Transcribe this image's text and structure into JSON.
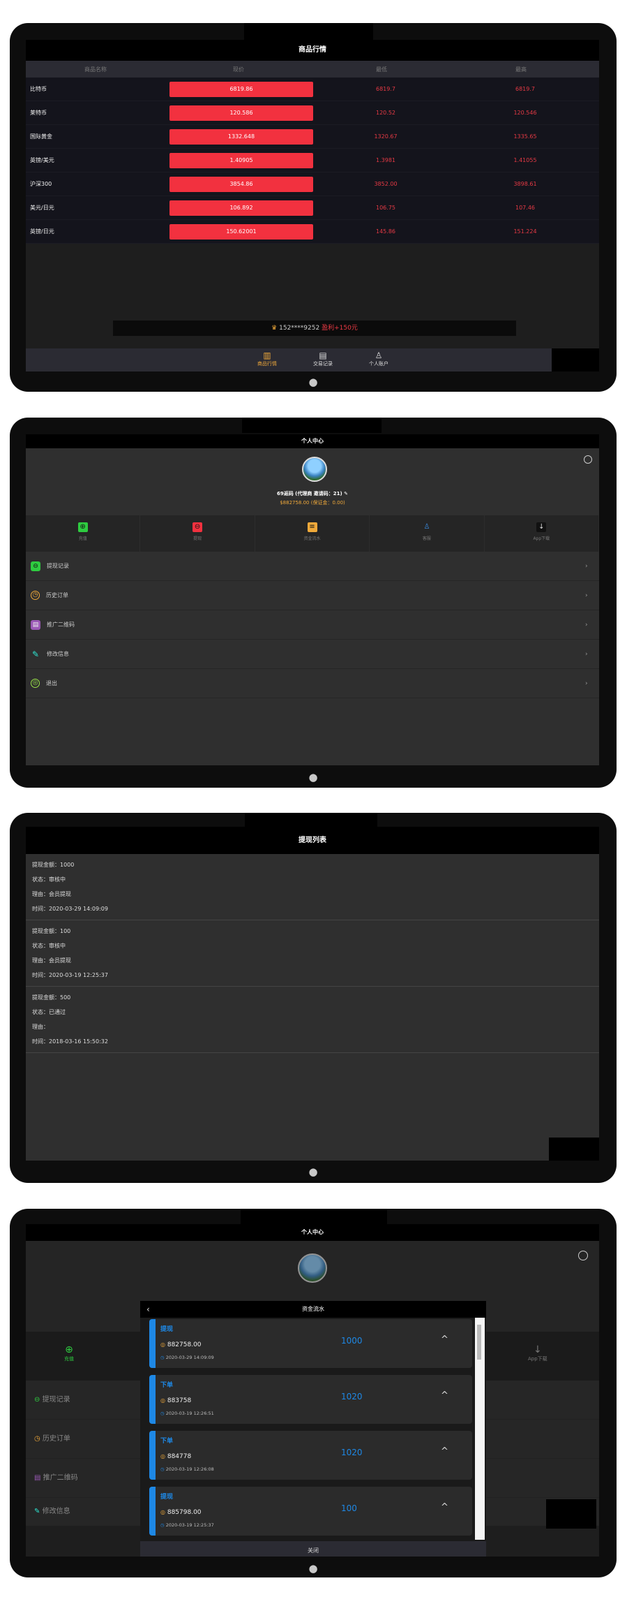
{
  "screen1": {
    "title": "商品行情",
    "columns": [
      "商品名称",
      "现价",
      "最低",
      "最高"
    ],
    "rows": [
      {
        "name": "比特币",
        "price": "6819.86",
        "low": "6819.7",
        "high": "6819.7"
      },
      {
        "name": "莱特币",
        "price": "120.586",
        "low": "120.52",
        "high": "120.546"
      },
      {
        "name": "国际黄金",
        "price": "1332.648",
        "low": "1320.67",
        "high": "1335.65"
      },
      {
        "name": "英镑/美元",
        "price": "1.40905",
        "low": "1.3981",
        "high": "1.41055"
      },
      {
        "name": "沪深300",
        "price": "3854.86",
        "low": "3852.00",
        "high": "3898.61"
      },
      {
        "name": "美元/日元",
        "price": "106.892",
        "low": "106.75",
        "high": "107.46"
      },
      {
        "name": "英镑/日元",
        "price": "150.62001",
        "low": "145.86",
        "high": "151.224"
      }
    ],
    "ticker_user": "152****9252",
    "ticker_gain": "盈利+150元",
    "tabs": [
      "商品行情",
      "交易记录",
      "个人账户"
    ]
  },
  "screen2": {
    "title": "个人中心",
    "username": "69返码 (代理商 邀请码：21)",
    "balance": "$882758.00 (保证金：0.00)",
    "quick": [
      "充值",
      "提现",
      "资金流水",
      "客服",
      "App下载"
    ],
    "menu": [
      "提现记录",
      "历史订单",
      "推广二维码",
      "修改信息",
      "退出"
    ]
  },
  "screen3": {
    "title": "提现列表",
    "items": [
      {
        "amount": "提现金额：1000",
        "status": "状态：审核中",
        "reason": "理由：会员提现",
        "time": "时间：2020-03-29 14:09:09"
      },
      {
        "amount": "提现金额：100",
        "status": "状态：审核中",
        "reason": "理由：会员提现",
        "time": "时间：2020-03-19 12:25:37"
      },
      {
        "amount": "提现金额：500",
        "status": "状态：已通过",
        "reason": "理由：",
        "time": "时间：2018-03-16 15:50:32"
      }
    ]
  },
  "screen4": {
    "title": "个人中心",
    "modal_title": "资金流水",
    "close_label": "关闭",
    "bg_quick_first": "充值",
    "bg_quick_last": "App下载",
    "bg_menu": [
      "提现记录",
      "历史订单",
      "推广二维码",
      "修改信息"
    ],
    "cards": [
      {
        "type": "提现",
        "balance": "882758.00",
        "date": "2020-03-29 14:09:09",
        "amount": "1000"
      },
      {
        "type": "下单",
        "balance": "883758",
        "date": "2020-03-19 12:26:51",
        "amount": "1020"
      },
      {
        "type": "下单",
        "balance": "884778",
        "date": "2020-03-19 12:26:08",
        "amount": "1020"
      },
      {
        "type": "提现",
        "balance": "885798.00",
        "date": "2020-03-19 12:25:37",
        "amount": "100"
      }
    ]
  },
  "colors": {
    "accent_red": "#f2313f",
    "accent_blue": "#1e88e5",
    "accent_orange": "#f0a93a"
  }
}
